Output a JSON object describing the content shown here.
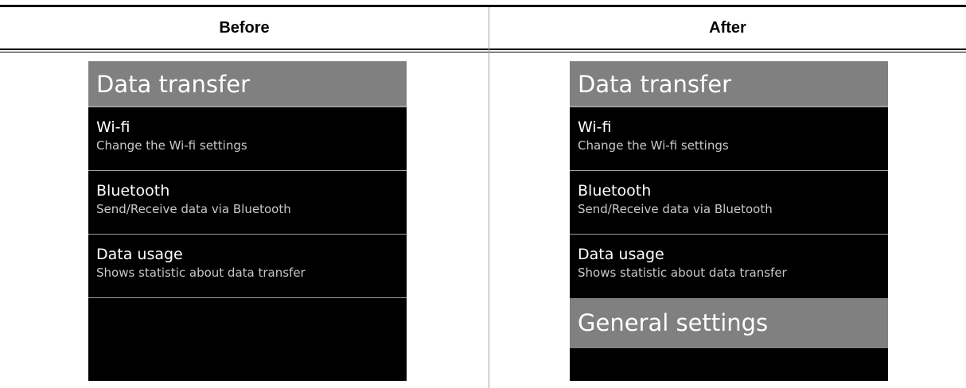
{
  "columns": {
    "before": {
      "header": "Before",
      "title": "Data transfer",
      "items": [
        {
          "title": "Wi-fi",
          "subtitle": "Change the Wi-fi settings"
        },
        {
          "title": "Bluetooth",
          "subtitle": "Send/Receive data via Bluetooth"
        },
        {
          "title": "Data usage",
          "subtitle": "Shows statistic about data transfer"
        }
      ]
    },
    "after": {
      "header": "After",
      "title": "Data transfer",
      "items": [
        {
          "title": "Wi-fi",
          "subtitle": "Change the Wi-fi settings"
        },
        {
          "title": "Bluetooth",
          "subtitle": "Send/Receive data via Bluetooth"
        },
        {
          "title": "Data usage",
          "subtitle": "Shows statistic about data transfer"
        }
      ],
      "section": "General settings"
    }
  },
  "colors": {
    "screen_background": "#000000",
    "bar_background": "#808080",
    "text": "#ffffff",
    "separator": "#a0a0a0"
  }
}
